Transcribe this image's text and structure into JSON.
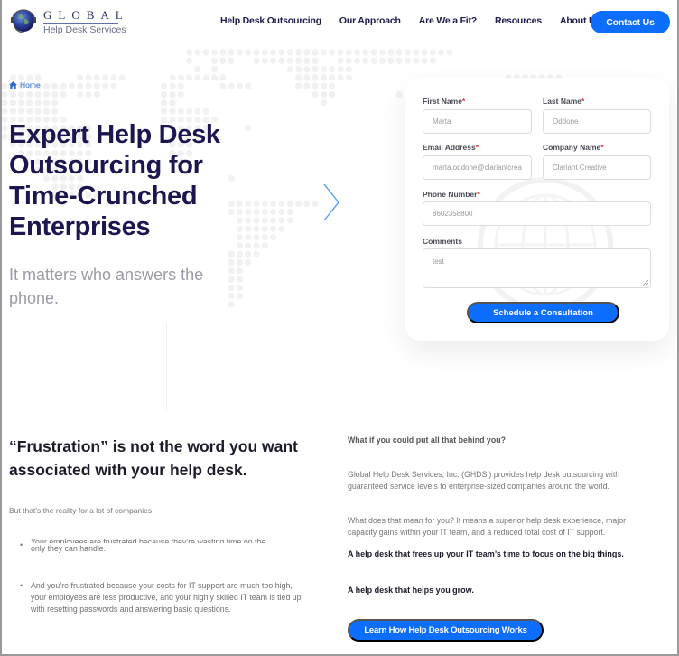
{
  "header": {
    "logo": {
      "title": "GLOBAL",
      "subtitle": "Help Desk Services"
    },
    "nav": [
      {
        "label": "Help Desk Outsourcing"
      },
      {
        "label": "Our Approach"
      },
      {
        "label": "Are We a Fit?"
      },
      {
        "label": "Resources"
      },
      {
        "label": "About Us"
      }
    ],
    "contact_label": "Contact Us"
  },
  "hero": {
    "breadcrumb": {
      "icon": "home-icon",
      "label": "Home"
    },
    "title": "Expert Help Desk Outsourcing for Time-Crunched Enterprises",
    "subtitle": "It matters who answers the phone.",
    "next_icon": "chevron-right-icon"
  },
  "form": {
    "required_mark": "*",
    "first_name": {
      "label": "First Name",
      "value": "Marta"
    },
    "last_name": {
      "label": "Last Name",
      "value": "Oddone"
    },
    "email": {
      "label": "Email Address",
      "value": "marta.oddone@clariantcrea"
    },
    "company": {
      "label": "Company Name",
      "value": "Clariant Creative"
    },
    "phone": {
      "label": "Phone Number",
      "value": "8602358800"
    },
    "comments": {
      "label": "Comments",
      "value": "test"
    },
    "submit_label": "Schedule a Consultation"
  },
  "frustration": {
    "title": "“Frustration” is not the word you want associated with your help desk.",
    "intro": "But that’s the reality for a lot of companies.",
    "bullets": [
      {
        "line_clipped": "Your employees are frustrated because they’re wasting time on the",
        "line_rest": "only they can handle."
      },
      {
        "text": "And you’re frustrated because your costs for IT support are much too high, your employees are less productive, and your highly skilled IT team is tied up with resetting passwords and answering basic questions."
      }
    ]
  },
  "solution": {
    "question": "What if you could put all that behind you?",
    "para1": "Global Help Desk Services, Inc. (GHDSi) provides help desk outsourcing with guaranteed service levels to enterprise-sized companies around the world.",
    "para2": "What does that mean for you? It means a superior help desk experience, major capacity gains within your IT team, and a reduced total cost of IT support.",
    "bold1": "A help desk that frees up your IT team’s time to focus on the big things.",
    "bold2": "A help desk that helps you grow.",
    "cta_label": "Learn How Help Desk Outsourcing Works"
  },
  "colors": {
    "accent": "#0d6efd",
    "heading": "#1b1650",
    "required": "#e0303a",
    "breadcrumb": "#2f6bd8"
  }
}
